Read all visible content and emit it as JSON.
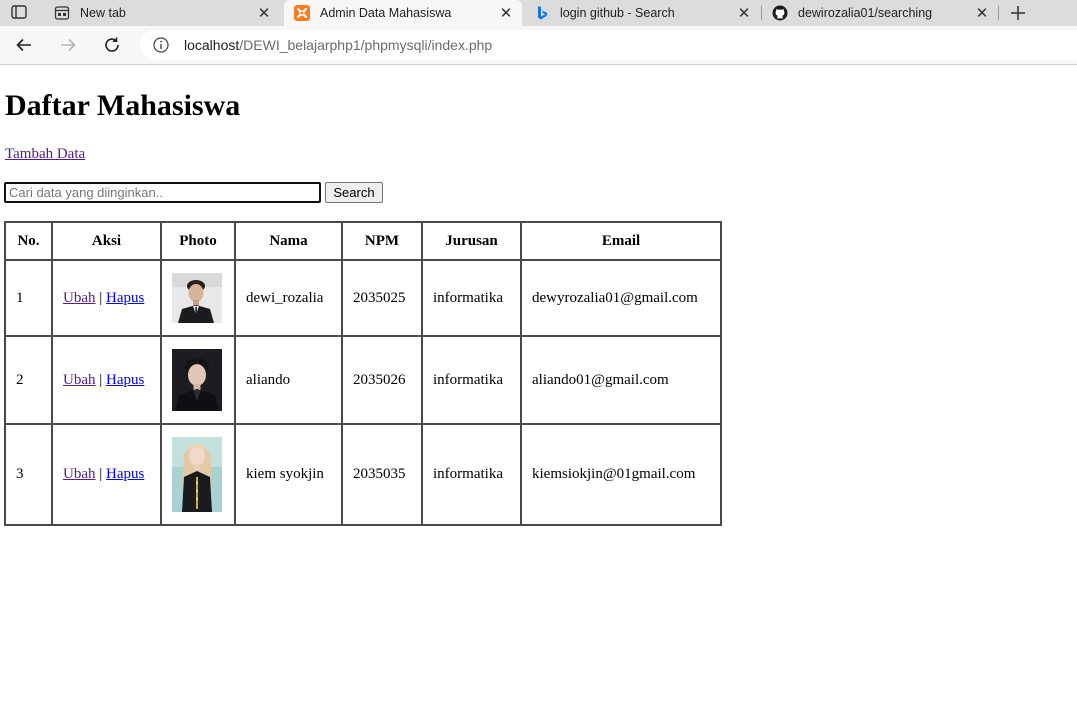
{
  "browser": {
    "tabs": [
      {
        "title": "New tab",
        "icon": "new-tab-icon",
        "active": false
      },
      {
        "title": "Admin Data Mahasiswa",
        "icon": "xampp-icon",
        "active": true
      },
      {
        "title": "login github - Search",
        "icon": "bing-icon",
        "active": false
      },
      {
        "title": "dewirozalia01/searching",
        "icon": "github-icon",
        "active": false
      }
    ],
    "address": {
      "host": "localhost",
      "path": "/DEWI_belajarphp1/phpmysqli/index.php"
    }
  },
  "page": {
    "title": "Daftar Mahasiswa",
    "add_link": "Tambah Data",
    "search": {
      "placeholder": "Cari data yang diinginkan..",
      "value": "",
      "button": "Search"
    },
    "table": {
      "headers": [
        "No.",
        "Aksi",
        "Photo",
        "Nama",
        "NPM",
        "Jurusan",
        "Email"
      ],
      "action_edit": "Ubah",
      "action_sep": "|",
      "action_delete": "Hapus",
      "rows": [
        {
          "no": "1",
          "nama": "dewi_rozalia",
          "npm": "2035025",
          "jurusan": "informatika",
          "email": "dewyrozalia01@gmail.com",
          "photo": "portrait-man-dark-suit"
        },
        {
          "no": "2",
          "nama": "aliando",
          "npm": "2035026",
          "jurusan": "informatika",
          "email": "aliando01@gmail.com",
          "photo": "portrait-man-dark-jacket"
        },
        {
          "no": "3",
          "nama": "kiem syokjin",
          "npm": "2035035",
          "jurusan": "informatika",
          "email": "kiemsiokjin@01gmail.com",
          "photo": "portrait-woman-blonde"
        }
      ]
    }
  },
  "colors": {
    "visited_link": "#551a8b",
    "link": "#0000ee",
    "xampp_orange": "#fb7a24",
    "bing_blue": "#1a73e8"
  }
}
